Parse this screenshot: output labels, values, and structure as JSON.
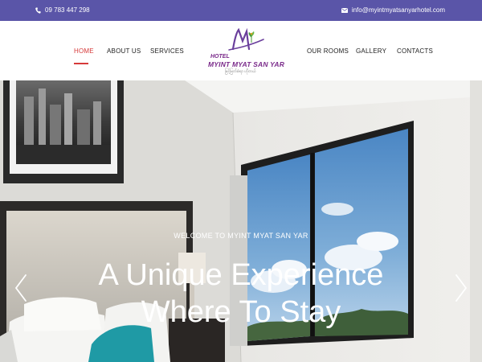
{
  "topbar": {
    "phone": "09 783 447 298",
    "email": "info@myintmyatsanyarhotel.com",
    "background": "#5a55a8"
  },
  "nav": {
    "home": "HOME",
    "about": "ABOUT US",
    "services": "SERVICES",
    "rooms": "OUR ROOMS",
    "gallery": "GALLERY",
    "contacts": "CONTACTS",
    "active_color": "#d63a3a"
  },
  "logo": {
    "word": "HOTEL",
    "name": "MYINT MYAT SAN YAR",
    "subtitle": "မြင့်မြတ်စံရာ ဟိုတယ်"
  },
  "hero": {
    "welcome": "WELCOME TO MYINT MYAT SAN YAR",
    "title_line1": "A Unique Experience",
    "title_line2": "Where To Stay"
  },
  "icons": {
    "phone": "phone-icon",
    "email": "envelope-icon",
    "prev": "chevron-left-icon",
    "next": "chevron-right-icon"
  }
}
